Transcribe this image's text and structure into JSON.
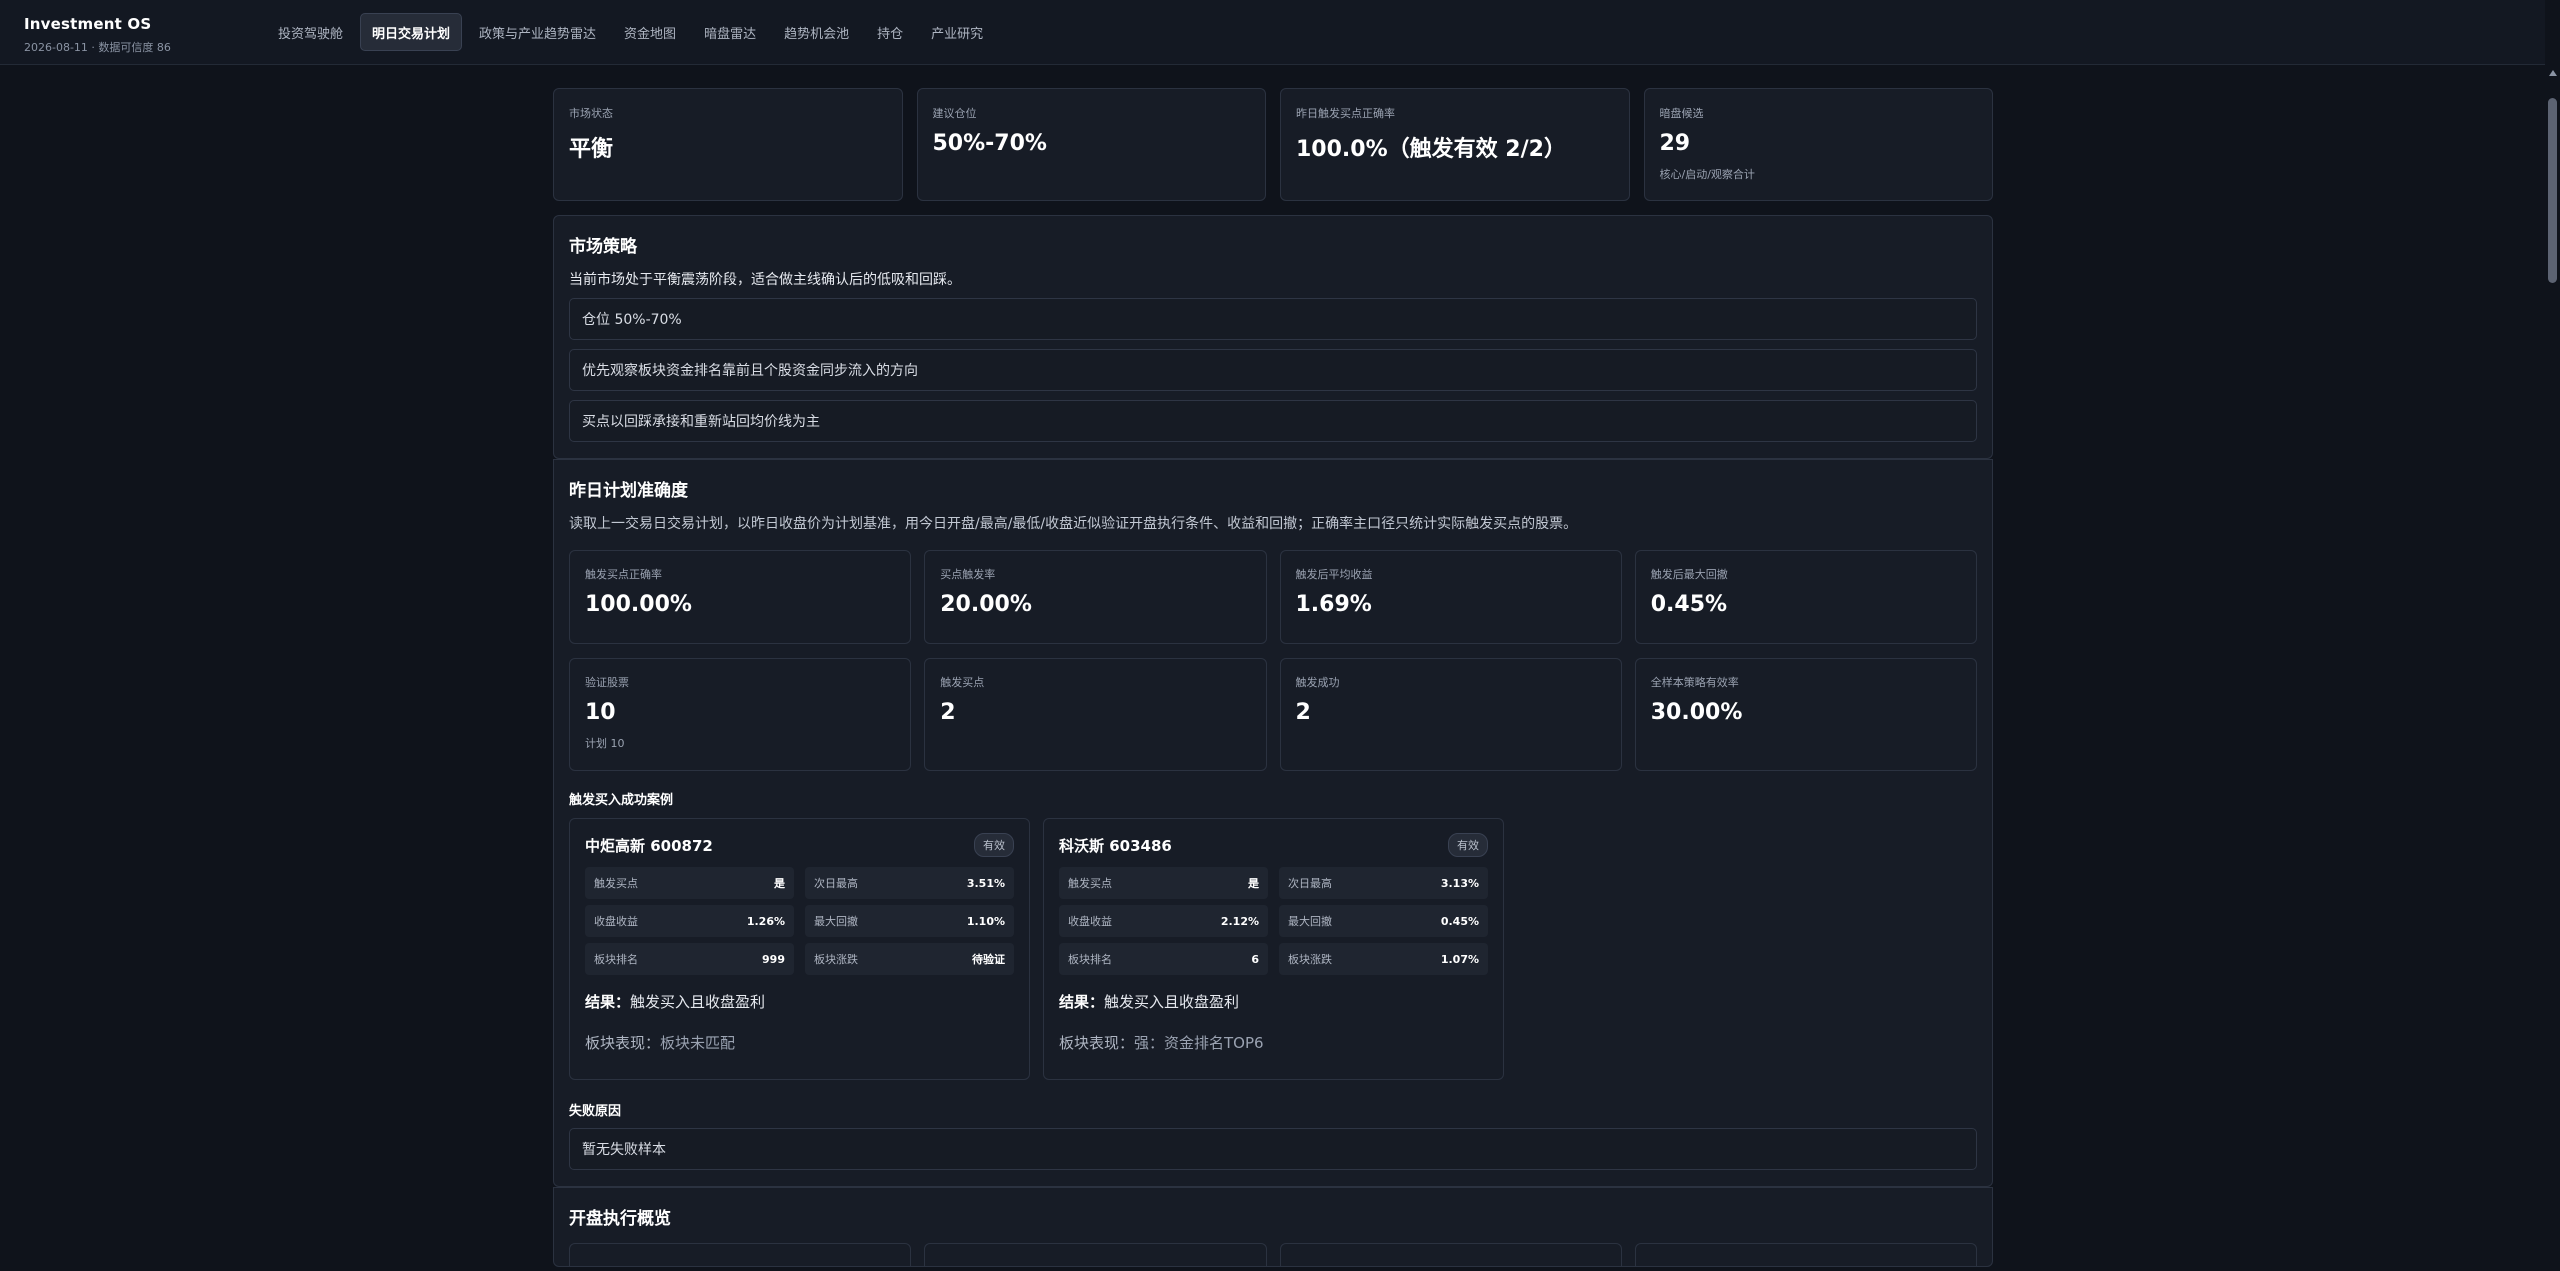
{
  "app": {
    "title": "Investment OS",
    "subtitle": "2026-08-11 · 数据可信度 86"
  },
  "nav": [
    {
      "label": "投资驾驶舱"
    },
    {
      "label": "明日交易计划"
    },
    {
      "label": "政策与产业趋势雷达"
    },
    {
      "label": "资金地图"
    },
    {
      "label": "暗盘雷达"
    },
    {
      "label": "趋势机会池"
    },
    {
      "label": "持仓"
    },
    {
      "label": "产业研究"
    }
  ],
  "summary": [
    {
      "label": "市场状态",
      "value": "平衡",
      "sub": ""
    },
    {
      "label": "建议仓位",
      "value": "50%-70%",
      "sub": ""
    },
    {
      "label": "昨日触发买点正确率",
      "value": "100.0%（触发有效 2/2）",
      "sub": ""
    },
    {
      "label": "暗盘候选",
      "value": "29",
      "sub": "核心/启动/观察合计"
    }
  ],
  "strategy": {
    "title": "市场策略",
    "desc": "当前市场处于平衡震荡阶段，适合做主线确认后的低吸和回踩。",
    "items": [
      "仓位 50%-70%",
      "优先观察板块资金排名靠前且个股资金同步流入的方向",
      "买点以回踩承接和重新站回均价线为主"
    ]
  },
  "accuracy": {
    "title": "昨日计划准确度",
    "desc": "读取上一交易日交易计划，以昨日收盘价为计划基准，用今日开盘/最高/最低/收盘近似验证开盘执行条件、收益和回撤；正确率主口径只统计实际触发买点的股票。",
    "metrics_row1": [
      {
        "label": "触发买点正确率",
        "value": "100.00%",
        "sub": ""
      },
      {
        "label": "买点触发率",
        "value": "20.00%",
        "sub": ""
      },
      {
        "label": "触发后平均收益",
        "value": "1.69%",
        "sub": ""
      },
      {
        "label": "触发后最大回撤",
        "value": "0.45%",
        "sub": ""
      }
    ],
    "metrics_row2": [
      {
        "label": "验证股票",
        "value": "10",
        "sub": "计划 10"
      },
      {
        "label": "触发买点",
        "value": "2",
        "sub": ""
      },
      {
        "label": "触发成功",
        "value": "2",
        "sub": ""
      },
      {
        "label": "全样本策略有效率",
        "value": "30.00%",
        "sub": ""
      }
    ],
    "cases_title": "触发买入成功案例",
    "cases": [
      {
        "name": "中炬高新 600872",
        "badge": "有效",
        "kv": [
          {
            "k": "触发买点",
            "v": "是"
          },
          {
            "k": "次日最高",
            "v": "3.51%"
          },
          {
            "k": "收盘收益",
            "v": "1.26%"
          },
          {
            "k": "最大回撤",
            "v": "1.10%"
          },
          {
            "k": "板块排名",
            "v": "999"
          },
          {
            "k": "板块涨跌",
            "v": "待验证"
          }
        ],
        "result_label": "结果：",
        "result": "触发买入且收盘盈利",
        "board_label": "板块表现：",
        "board": "板块未匹配"
      },
      {
        "name": "科沃斯 603486",
        "badge": "有效",
        "kv": [
          {
            "k": "触发买点",
            "v": "是"
          },
          {
            "k": "次日最高",
            "v": "3.13%"
          },
          {
            "k": "收盘收益",
            "v": "2.12%"
          },
          {
            "k": "最大回撤",
            "v": "0.45%"
          },
          {
            "k": "板块排名",
            "v": "6"
          },
          {
            "k": "板块涨跌",
            "v": "1.07%"
          }
        ],
        "result_label": "结果：",
        "result": "触发买入且收盘盈利",
        "board_label": "板块表现：",
        "board": "强：资金排名TOP6"
      }
    ],
    "fail_title": "失败原因",
    "fail_text": "暂无失败样本"
  },
  "opening": {
    "title": "开盘执行概览"
  }
}
